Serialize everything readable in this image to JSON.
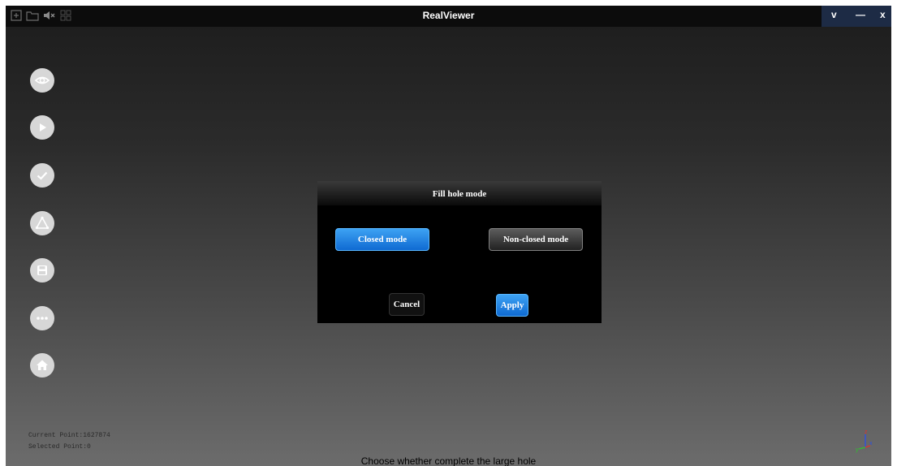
{
  "window": {
    "title": "RealViewer",
    "controls": [
      "v",
      "—",
      "x"
    ]
  },
  "toolbar_icons": [
    "new-file-icon",
    "open-folder-icon",
    "mute-icon",
    "grid-icon"
  ],
  "sidebar": {
    "items": [
      {
        "name": "view",
        "icon": "eye-icon"
      },
      {
        "name": "play",
        "icon": "play-icon"
      },
      {
        "name": "confirm",
        "icon": "check-icon"
      },
      {
        "name": "mesh",
        "icon": "triangle-mesh-icon"
      },
      {
        "name": "save",
        "icon": "save-icon"
      },
      {
        "name": "more",
        "icon": "more-icon"
      },
      {
        "name": "home",
        "icon": "home-icon"
      }
    ]
  },
  "status": {
    "current_point": "Current Point:1627874",
    "selected_point": "Selected Point:0"
  },
  "hint": "Choose whether complete the large hole",
  "dialog": {
    "title": "Fill hole mode",
    "closed_label": "Closed mode",
    "nonclosed_label": "Non-closed mode",
    "cancel_label": "Cancel",
    "apply_label": "Apply",
    "selected_mode": "Closed mode"
  },
  "axis": {
    "x": "x",
    "y": "y",
    "z": "z"
  },
  "colors": {
    "accent_blue": "#1a7ee6",
    "titlebar": "#0c0c0c",
    "controls_bg": "#1d2b45",
    "axis_x": "#e03030",
    "axis_y": "#30c030",
    "axis_z": "#3050e0"
  }
}
